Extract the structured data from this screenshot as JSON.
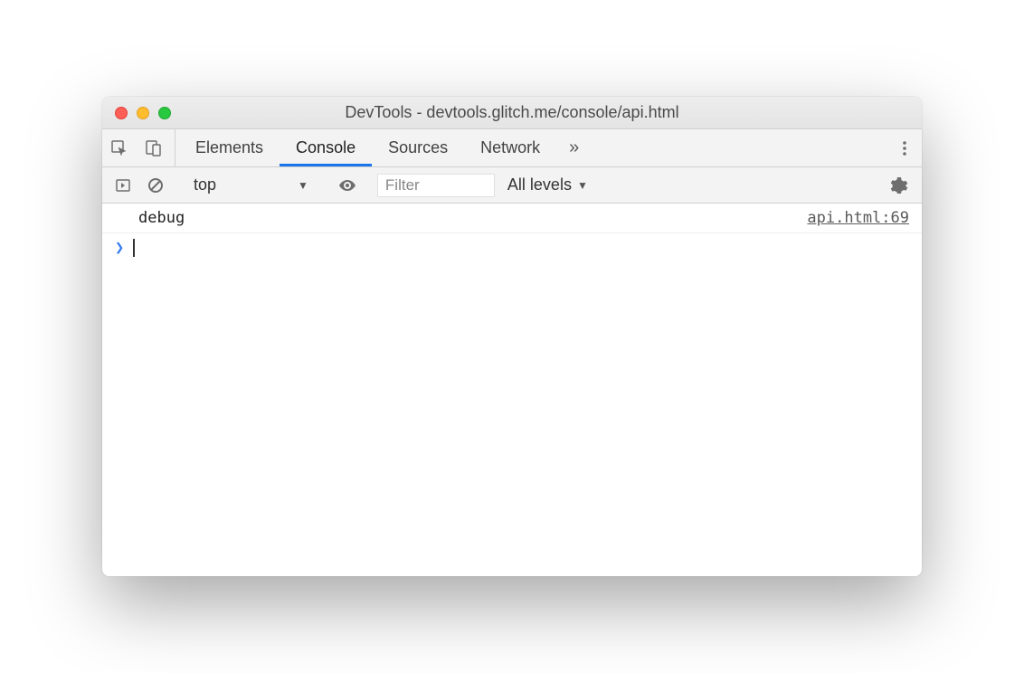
{
  "window": {
    "title": "DevTools - devtools.glitch.me/console/api.html"
  },
  "tabs": {
    "items": [
      "Elements",
      "Console",
      "Sources",
      "Network"
    ],
    "active": "Console",
    "more": "»"
  },
  "toolbar": {
    "context": "top",
    "filter_placeholder": "Filter",
    "levels": "All levels"
  },
  "console": {
    "rows": [
      {
        "message": "debug",
        "source": "api.html:69"
      }
    ],
    "prompt": "❯"
  }
}
